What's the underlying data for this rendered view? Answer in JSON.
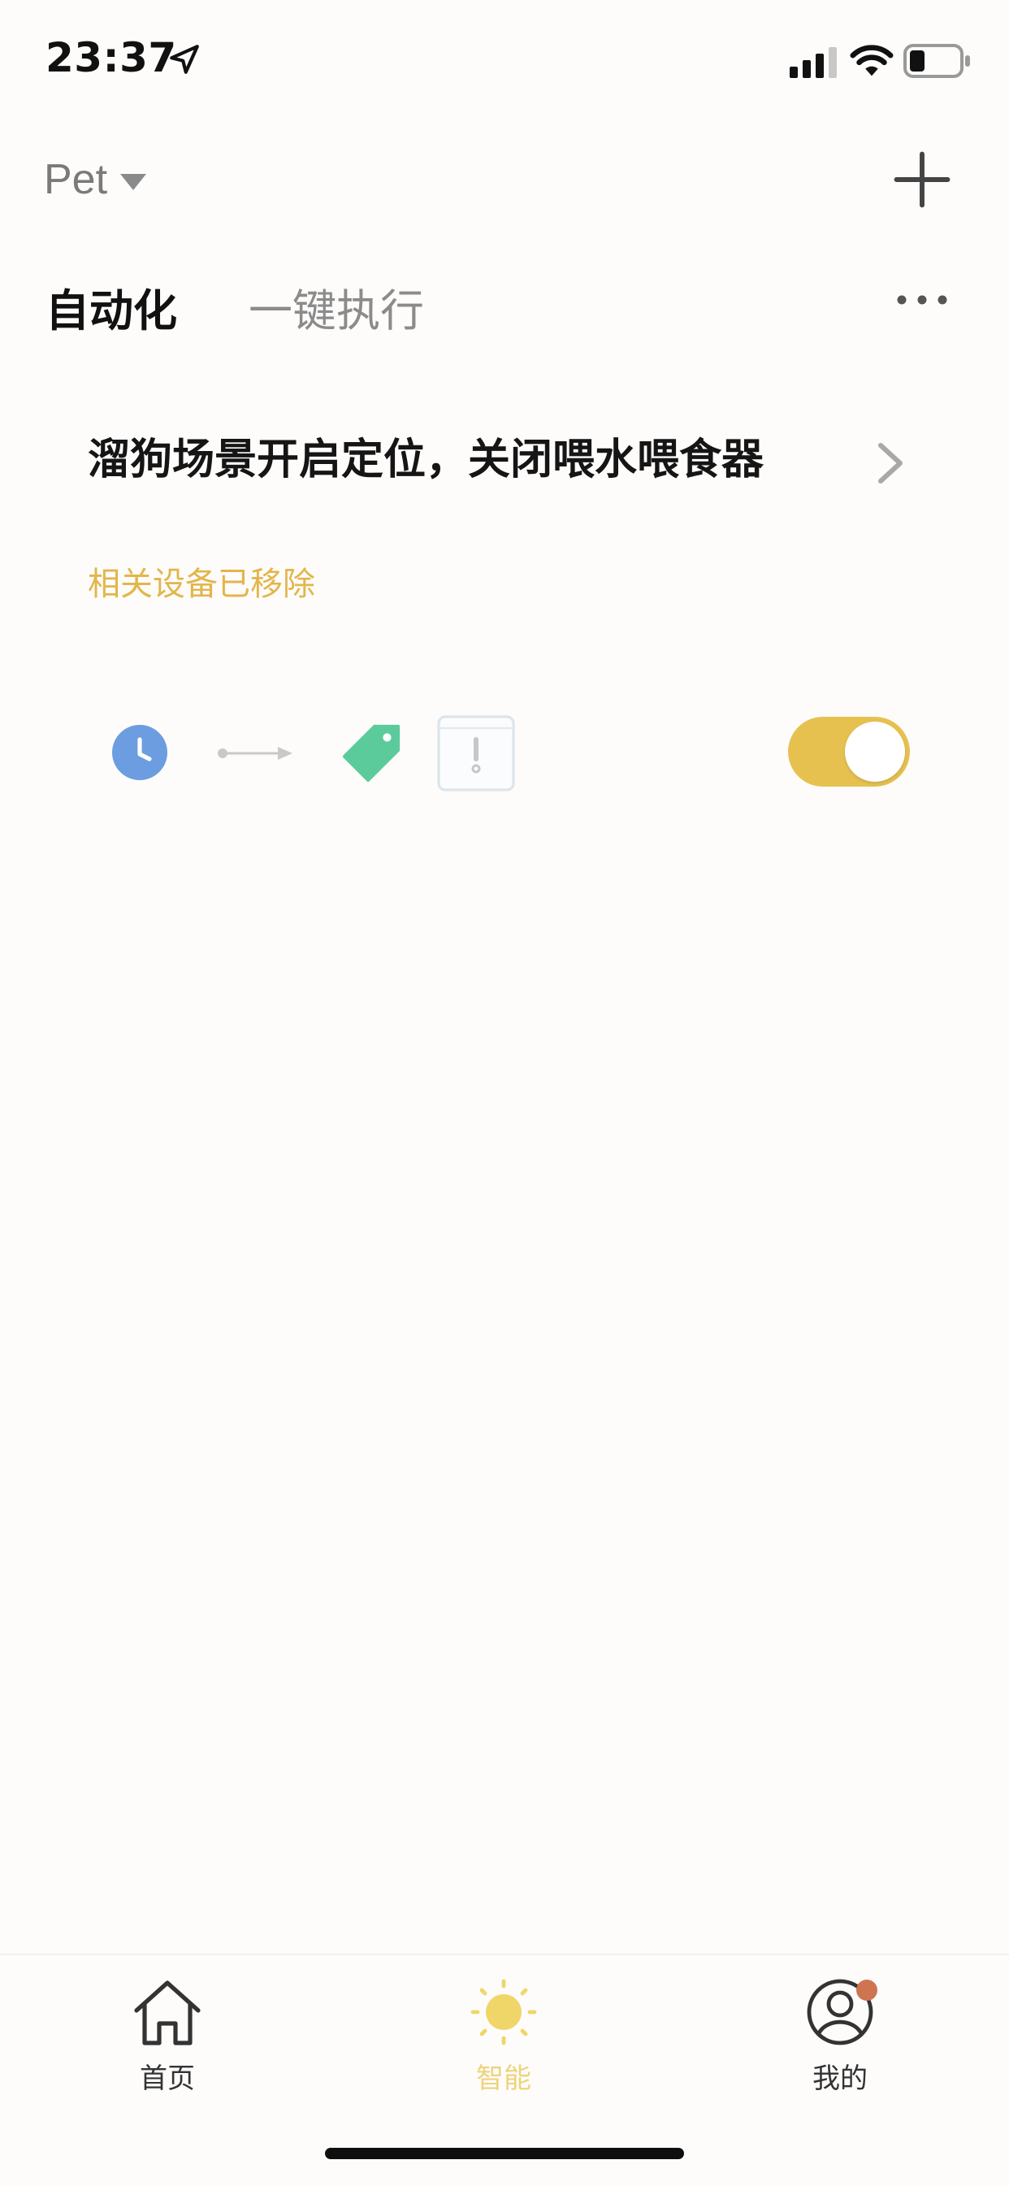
{
  "status_bar": {
    "time": "23:37",
    "location_icon": "location-arrow-icon",
    "signal_icon": "cellular-signal-icon",
    "wifi_icon": "wifi-icon",
    "battery_icon": "battery-icon"
  },
  "header": {
    "home_name": "Pet",
    "caret_icon": "caret-down-icon",
    "add_icon": "plus-icon"
  },
  "tabs": {
    "automation": "自动化",
    "one_tap": "一键执行",
    "more_icon": "more-horizontal-icon"
  },
  "automation_card": {
    "title": "溜狗场景开启定位，关闭喂水喂食器",
    "status": "相关设备已移除",
    "enabled": true,
    "icons": [
      "clock-icon",
      "arrow-right-icon",
      "tag-icon",
      "device-removed-icon"
    ]
  },
  "tabbar": {
    "items": [
      {
        "label": "首页",
        "icon": "home-icon",
        "active": false
      },
      {
        "label": "智能",
        "icon": "sun-icon",
        "active": true
      },
      {
        "label": "我的",
        "icon": "user-icon",
        "active": false,
        "badge": true
      }
    ]
  },
  "colors": {
    "accent": "#e7c150",
    "status_warning": "#e3b64b",
    "clock": "#6b9de0",
    "tag": "#5ccb9c",
    "badge": "#cf7450"
  }
}
